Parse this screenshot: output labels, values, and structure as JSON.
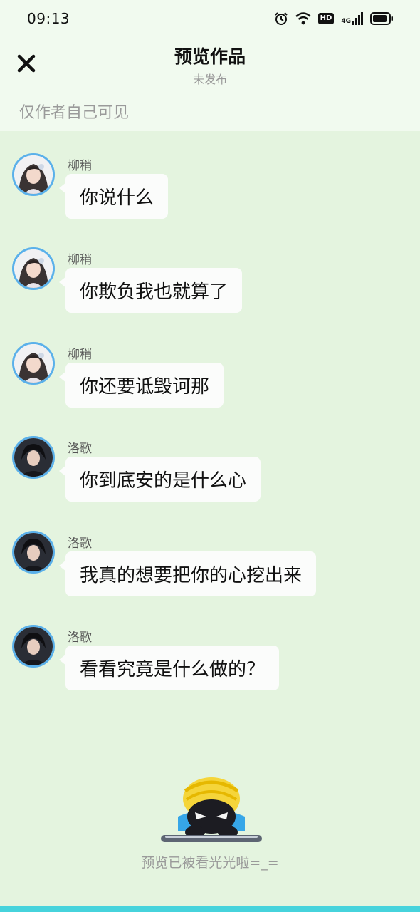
{
  "status_bar": {
    "time": "09:13",
    "hd_badge": "HD",
    "network": "4G"
  },
  "header": {
    "title": "预览作品",
    "subtitle": "未发布"
  },
  "visibility_note": "仅作者自己可见",
  "messages": [
    {
      "speaker": "柳稍",
      "text": "你说什么",
      "avatar_icon": "female-avatar"
    },
    {
      "speaker": "柳稍",
      "text": "你欺负我也就算了",
      "avatar_icon": "female-avatar"
    },
    {
      "speaker": "柳稍",
      "text": "你还要诋毁诃那",
      "avatar_icon": "female-avatar"
    },
    {
      "speaker": "洛歌",
      "text": "你到底安的是什么心",
      "avatar_icon": "male-avatar"
    },
    {
      "speaker": "洛歌",
      "text": "我真的想要把你的心挖出来",
      "avatar_icon": "male-avatar"
    },
    {
      "speaker": "洛歌",
      "text": "看看究竟是什么做的？",
      "avatar_icon": "male-avatar"
    }
  ],
  "footer": {
    "text": "预览已被看光光啦=_="
  },
  "colors": {
    "background": "#e4f4df",
    "header_bg": "#f1faef",
    "avatar_ring": "#5ab0ea",
    "bottom_bar": "#46d3dc"
  }
}
